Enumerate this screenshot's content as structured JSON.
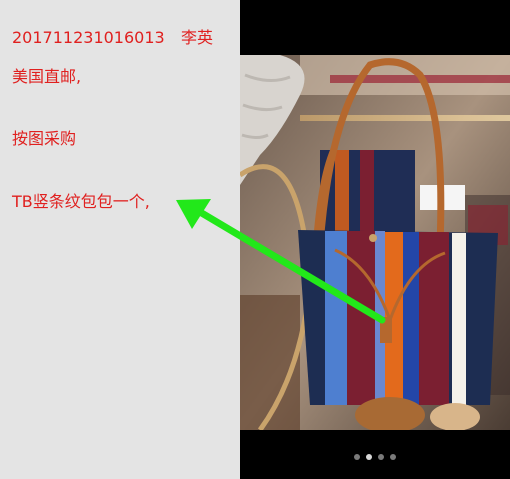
{
  "note": {
    "order_id": "201711231016013",
    "customer_name": "李英",
    "shipping": "美国直邮,",
    "instruction": "按图采购",
    "item": "TB竖条纹包包一个,"
  },
  "colors": {
    "text_red": "#e0201f",
    "arrow_green": "#22e81a",
    "left_panel_bg": "#e4e4e4",
    "viewer_bg": "#000000"
  },
  "photo": {
    "subject": "striped bucket handbag in store",
    "stripe_colors": [
      "#1d2d52",
      "#7b1f31",
      "#4e7fd0",
      "#e36a1c",
      "#2346a8",
      "#f4f1ea"
    ]
  },
  "pager": {
    "total": 4,
    "current": 2
  }
}
